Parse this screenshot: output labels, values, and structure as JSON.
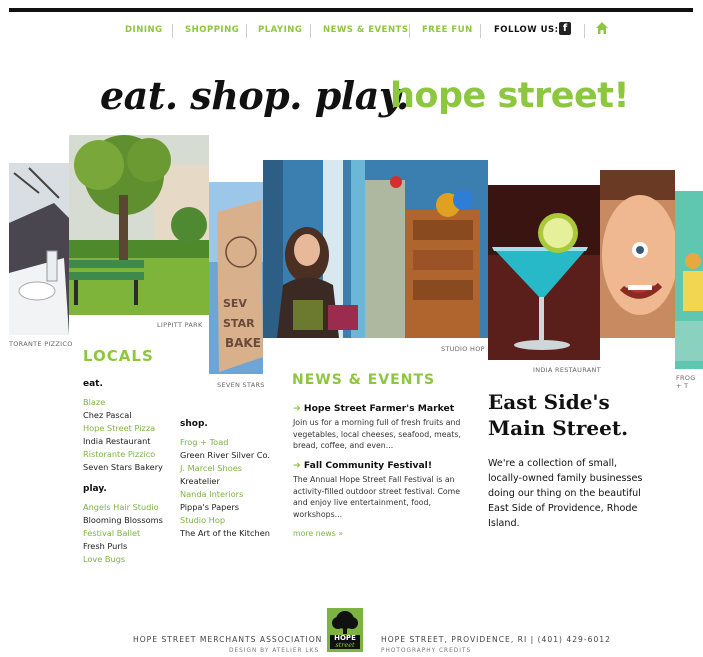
{
  "nav": {
    "items": [
      "DINING",
      "SHOPPING",
      "PLAYING",
      "NEWS & EVENTS",
      "FREE FUN"
    ],
    "follow_label": "FOLLOW US:",
    "facebook_glyph": "f"
  },
  "tagline": {
    "left": "eat. shop. play.",
    "right": "hope street!"
  },
  "photo_captions": {
    "p1": "TORANTE PIZZICO",
    "p2": "LIPPITT PARK",
    "p3": "SEVEN STARS",
    "p4": "STUDIO HOP",
    "p5": "INDIA RESTAURANT",
    "p7": "FROG + T"
  },
  "locals": {
    "title": "LOCALS",
    "eat_label": "eat.",
    "eat_items": [
      {
        "name": "Blaze",
        "linked": true
      },
      {
        "name": "Chez Pascal",
        "linked": false
      },
      {
        "name": "Hope Street Pizza",
        "linked": true
      },
      {
        "name": "India Restaurant",
        "linked": false
      },
      {
        "name": "Ristorante Pizzico",
        "linked": true
      },
      {
        "name": "Seven Stars Bakery",
        "linked": false
      }
    ],
    "play_label": "play.",
    "play_items": [
      {
        "name": "Angels Hair Studio",
        "linked": true
      },
      {
        "name": "Blooming Blossoms",
        "linked": false
      },
      {
        "name": "Festival Ballet",
        "linked": true
      },
      {
        "name": "Fresh Purls",
        "linked": false
      },
      {
        "name": "Love Bugs",
        "linked": true
      }
    ],
    "shop_label": "shop.",
    "shop_items": [
      {
        "name": "Frog + Toad",
        "linked": true
      },
      {
        "name": "Green River Silver Co.",
        "linked": false
      },
      {
        "name": "J. Marcel Shoes",
        "linked": true
      },
      {
        "name": "Kreatelier",
        "linked": false
      },
      {
        "name": "Nanda Interiors",
        "linked": true
      },
      {
        "name": "Pippa's Papers",
        "linked": false
      },
      {
        "name": "Studio Hop",
        "linked": true
      },
      {
        "name": "The Art of the Kitchen",
        "linked": false
      }
    ]
  },
  "news": {
    "title": "NEWS & EVENTS",
    "items": [
      {
        "title": "Hope Street Farmer's Market",
        "body": "Join us for a morning full of fresh fruits and vegetables, local cheeses, seafood, meats, bread, coffee, and even..."
      },
      {
        "title": "Fall Community Festival!",
        "body": "The Annual Hope Street Fall Festival is an activity-filled outdoor street festival. Come and enjoy live entertainment, food, workshops..."
      }
    ],
    "more_link": "more news »"
  },
  "main": {
    "heading_line1": "East Side's",
    "heading_line2": "Main Street.",
    "body": "We're a collection of small, locally-owned family businesses doing our thing on the beautiful East Side of Providence, Rhode Island."
  },
  "footer": {
    "org": "HOPE STREET MERCHANTS ASSOCIATION",
    "design_credit": "DESIGN BY ATELIER LKS",
    "address": "HOPE STREET, PROVIDENCE, RI  |  (401) 429-6012",
    "photo_credit": "PHOTOGRAPHY CREDITS",
    "logo_line1": "HOPE",
    "logo_line2": "street"
  },
  "colors": {
    "accent": "#8dc63f",
    "link": "#7cb342"
  }
}
